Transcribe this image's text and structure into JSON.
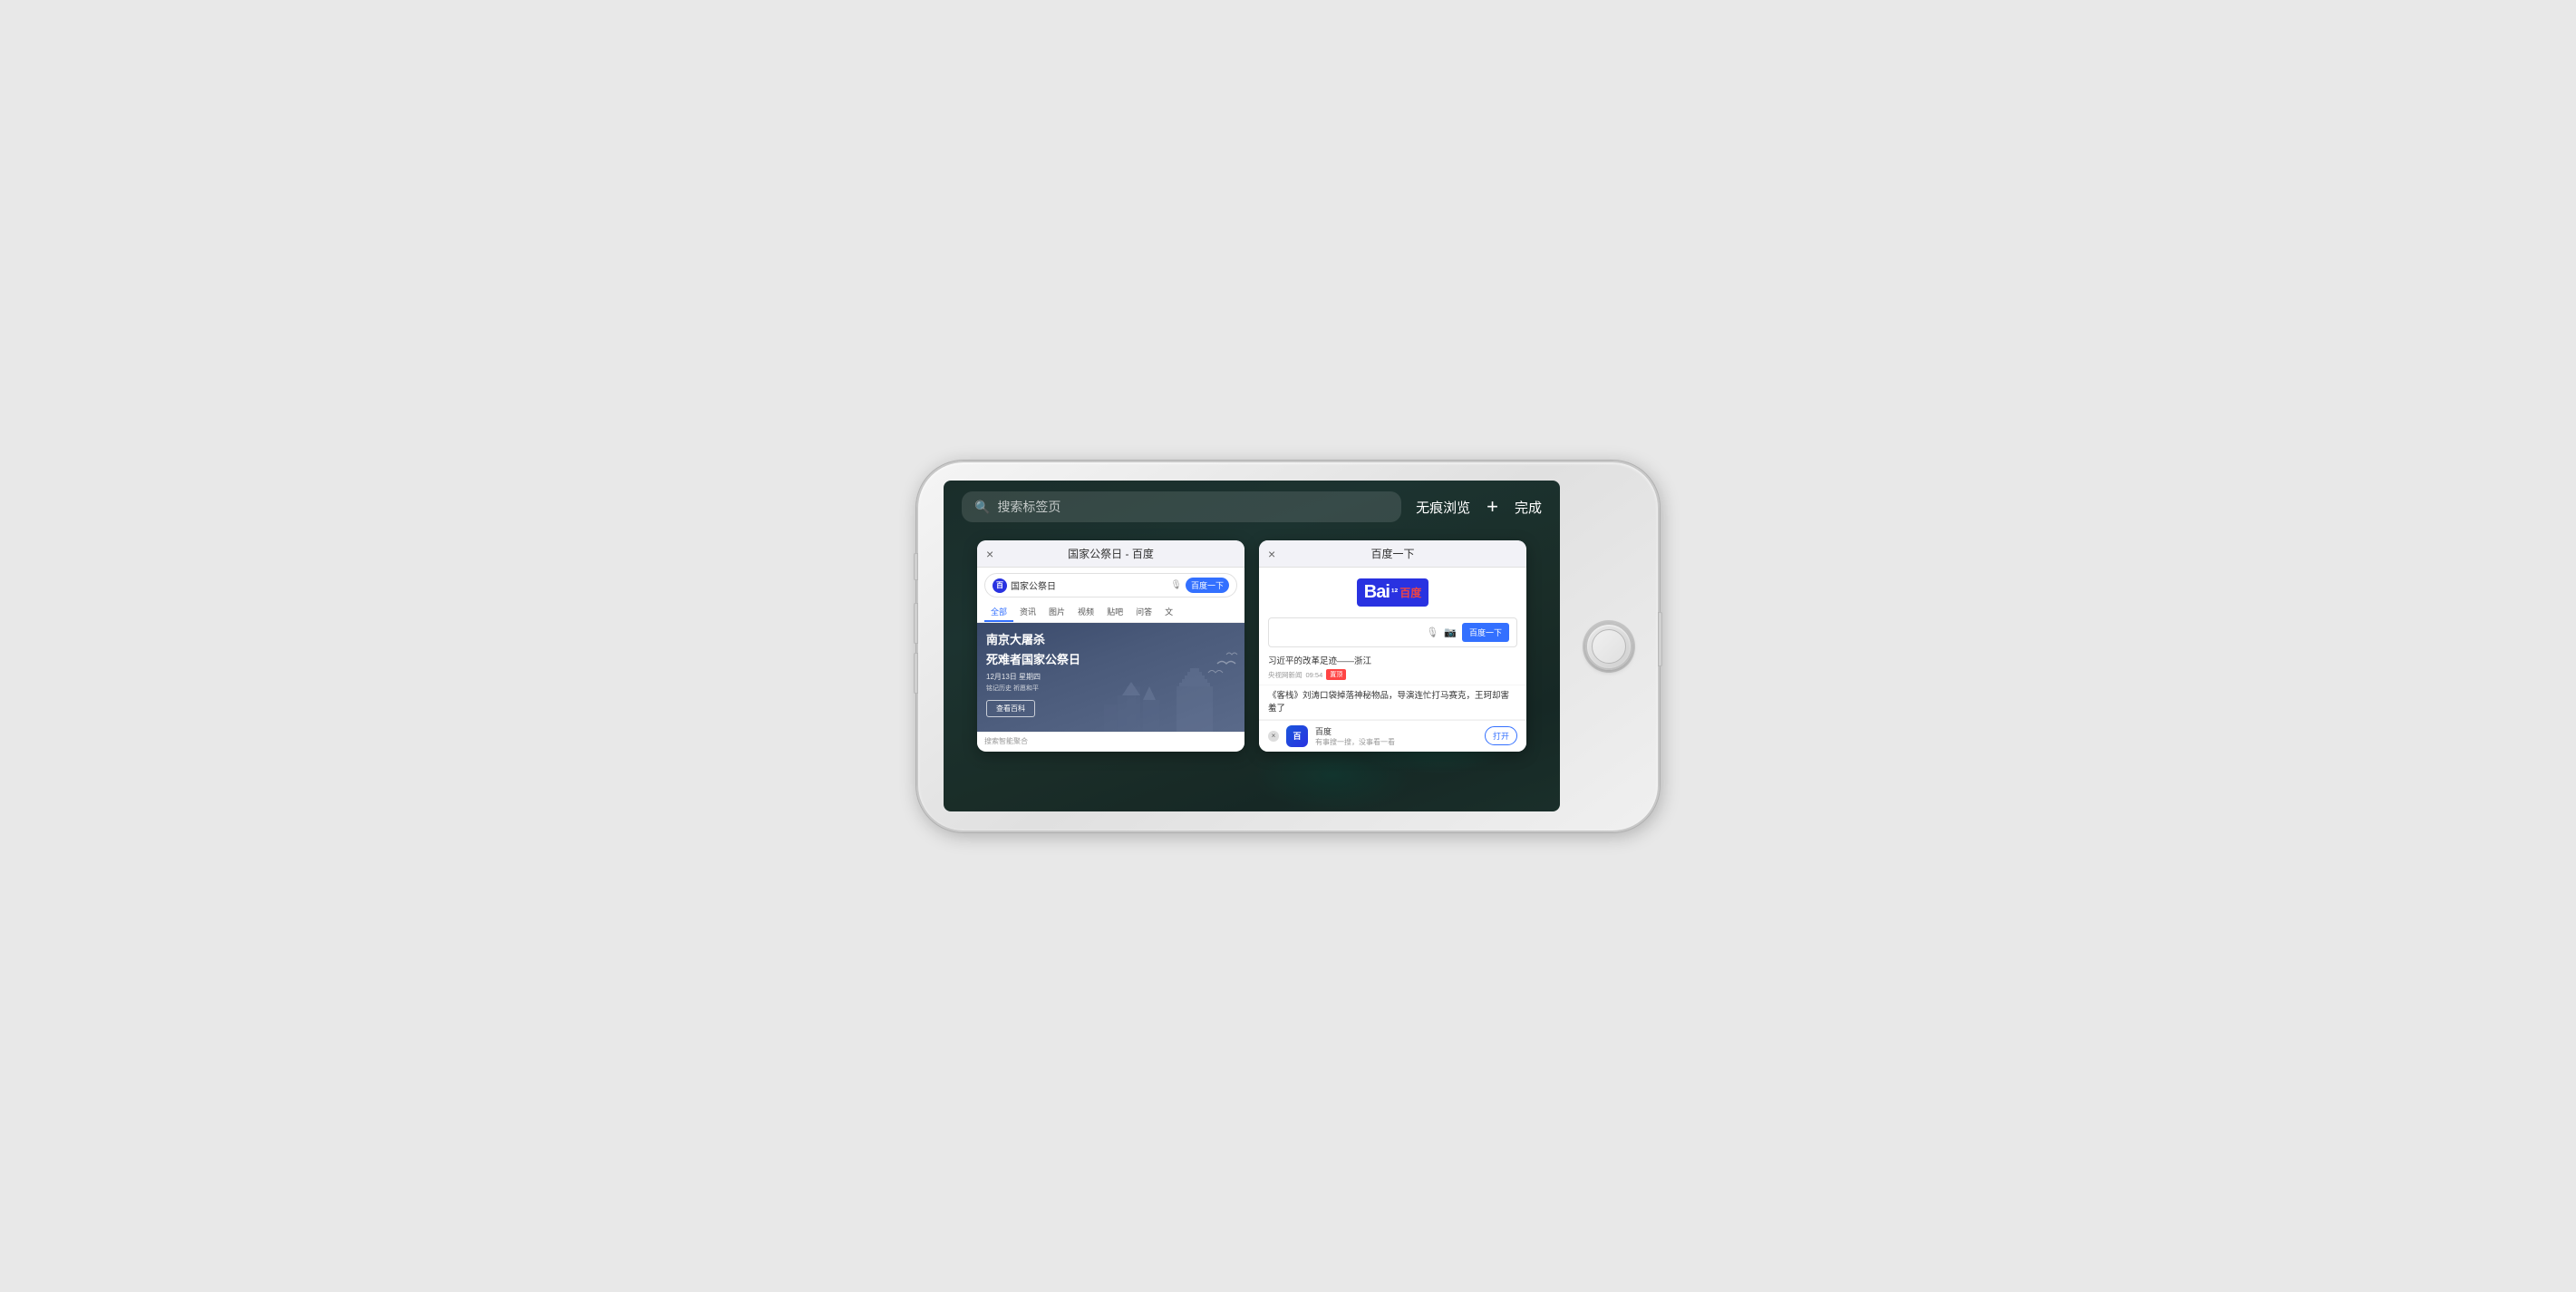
{
  "phone": {
    "search_placeholder": "搜索标签页",
    "incognito_label": "无痕浏览",
    "plus_label": "+",
    "done_label": "完成"
  },
  "tab1": {
    "title": "国家公祭日 - 百度",
    "close_icon": "×",
    "search_text": "国家公祭日",
    "baidu_btn": "百度一下",
    "nav_items": [
      "全部",
      "资讯",
      "图片",
      "视频",
      "贴吧",
      "问答",
      "文"
    ],
    "active_nav": "全部",
    "banner_title_line1": "南京大屠杀",
    "banner_title_line2": "死难者国家公祭日",
    "banner_date": "12月13日 星期四",
    "banner_sub": "铭记历史 祈愿和平",
    "banner_btn": "查看百科",
    "footer": "搜索智能聚合"
  },
  "tab2": {
    "title": "百度一下",
    "close_icon": "×",
    "logo_text": "Bai",
    "logo_num": "¹²",
    "logo_cn": "百度",
    "baidu_btn": "百度一下",
    "news1_title": "习近平的改革足迹——浙江",
    "news1_source": "央视网新闻",
    "news1_time": "09:54",
    "news1_tag": "置顶",
    "news2_title": "《客栈》刘涛口袋掉落神秘物品，导演连忙打马赛克，王珂却害羞了",
    "app_name": "百度",
    "app_desc": "有事搜一搜，没事看一看",
    "open_btn": "打开"
  }
}
